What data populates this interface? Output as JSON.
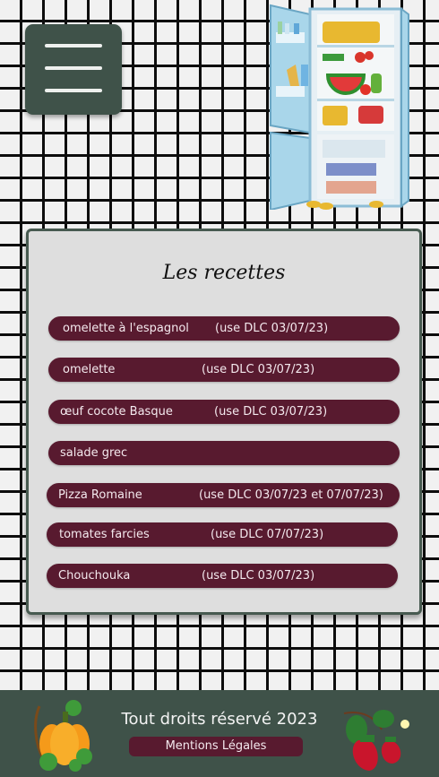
{
  "menu": {
    "icon": "hamburger-menu-icon"
  },
  "illustration": {
    "icon": "open-fridge-icon"
  },
  "recipes": {
    "title": "Les recettes",
    "items": [
      {
        "name": "omelette à l'espagnol",
        "dlc": "(use  DLC 03/07/23)"
      },
      {
        "name": "omelette",
        "dlc": "(use  DLC 03/07/23)"
      },
      {
        "name": "œuf cocote Basque",
        "dlc": "(use DLC 03/07/23)"
      },
      {
        "name": "salade grec",
        "dlc": ""
      },
      {
        "name": "Pizza Romaine",
        "dlc": "(use DLC 03/07/23 et 07/07/23)"
      },
      {
        "name": "tomates farcies",
        "dlc": "(use  DLC 07/07/23)"
      },
      {
        "name": "Chouchouka",
        "dlc": "(use DLC 03/07/23)"
      }
    ]
  },
  "footer": {
    "copyright": "Tout droits réservé 2023",
    "legal_label": "Mentions Légales",
    "left_icon": "pumpkin-icon",
    "right_icon": "strawberry-icon"
  },
  "colors": {
    "accent": "#581a2f",
    "panel": "#3f5249",
    "card": "#dedede"
  }
}
